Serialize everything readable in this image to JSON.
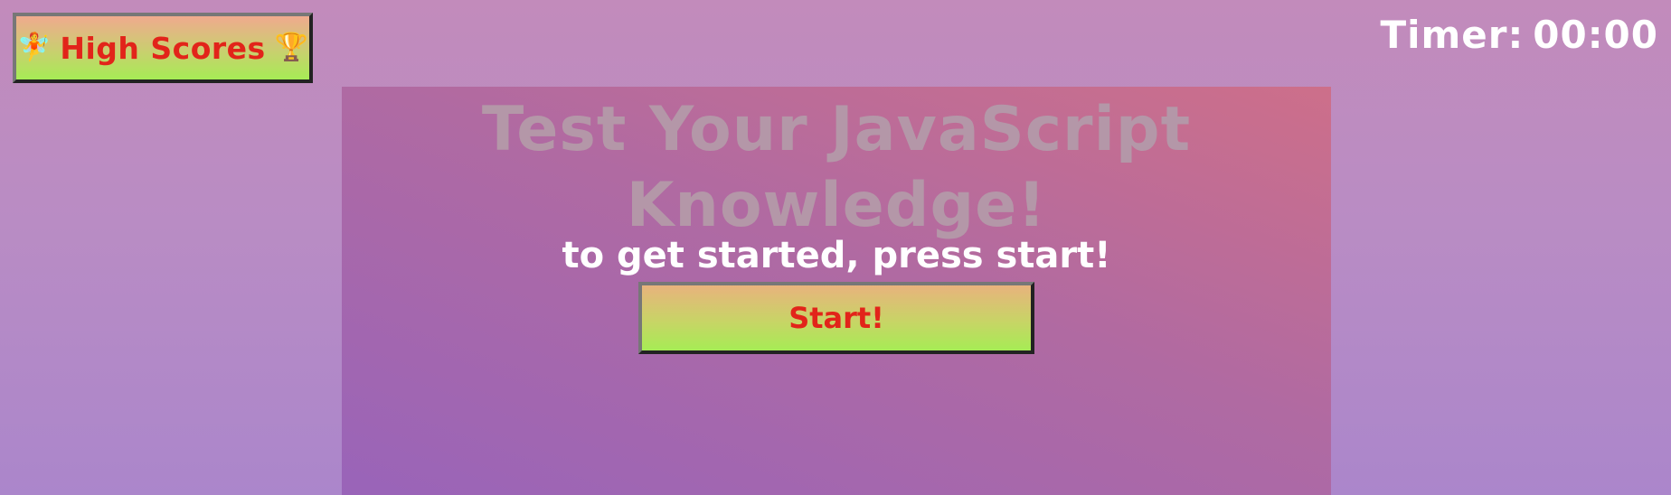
{
  "header": {
    "high_scores": {
      "left_icon": "fairy-icon",
      "label": "High Scores",
      "right_icon": "trophy-icon"
    },
    "timer": {
      "label": "Timer:",
      "value": "00:00"
    }
  },
  "main": {
    "title": "Test Your JavaScript Knowledge!",
    "subtitle": "to get started, press start!",
    "start_label": "Start!"
  },
  "colors": {
    "button_text": "#e2241a",
    "title_text": "#b497a8",
    "panel_top": "#cd6f8a",
    "panel_bottom": "#9964b9"
  }
}
